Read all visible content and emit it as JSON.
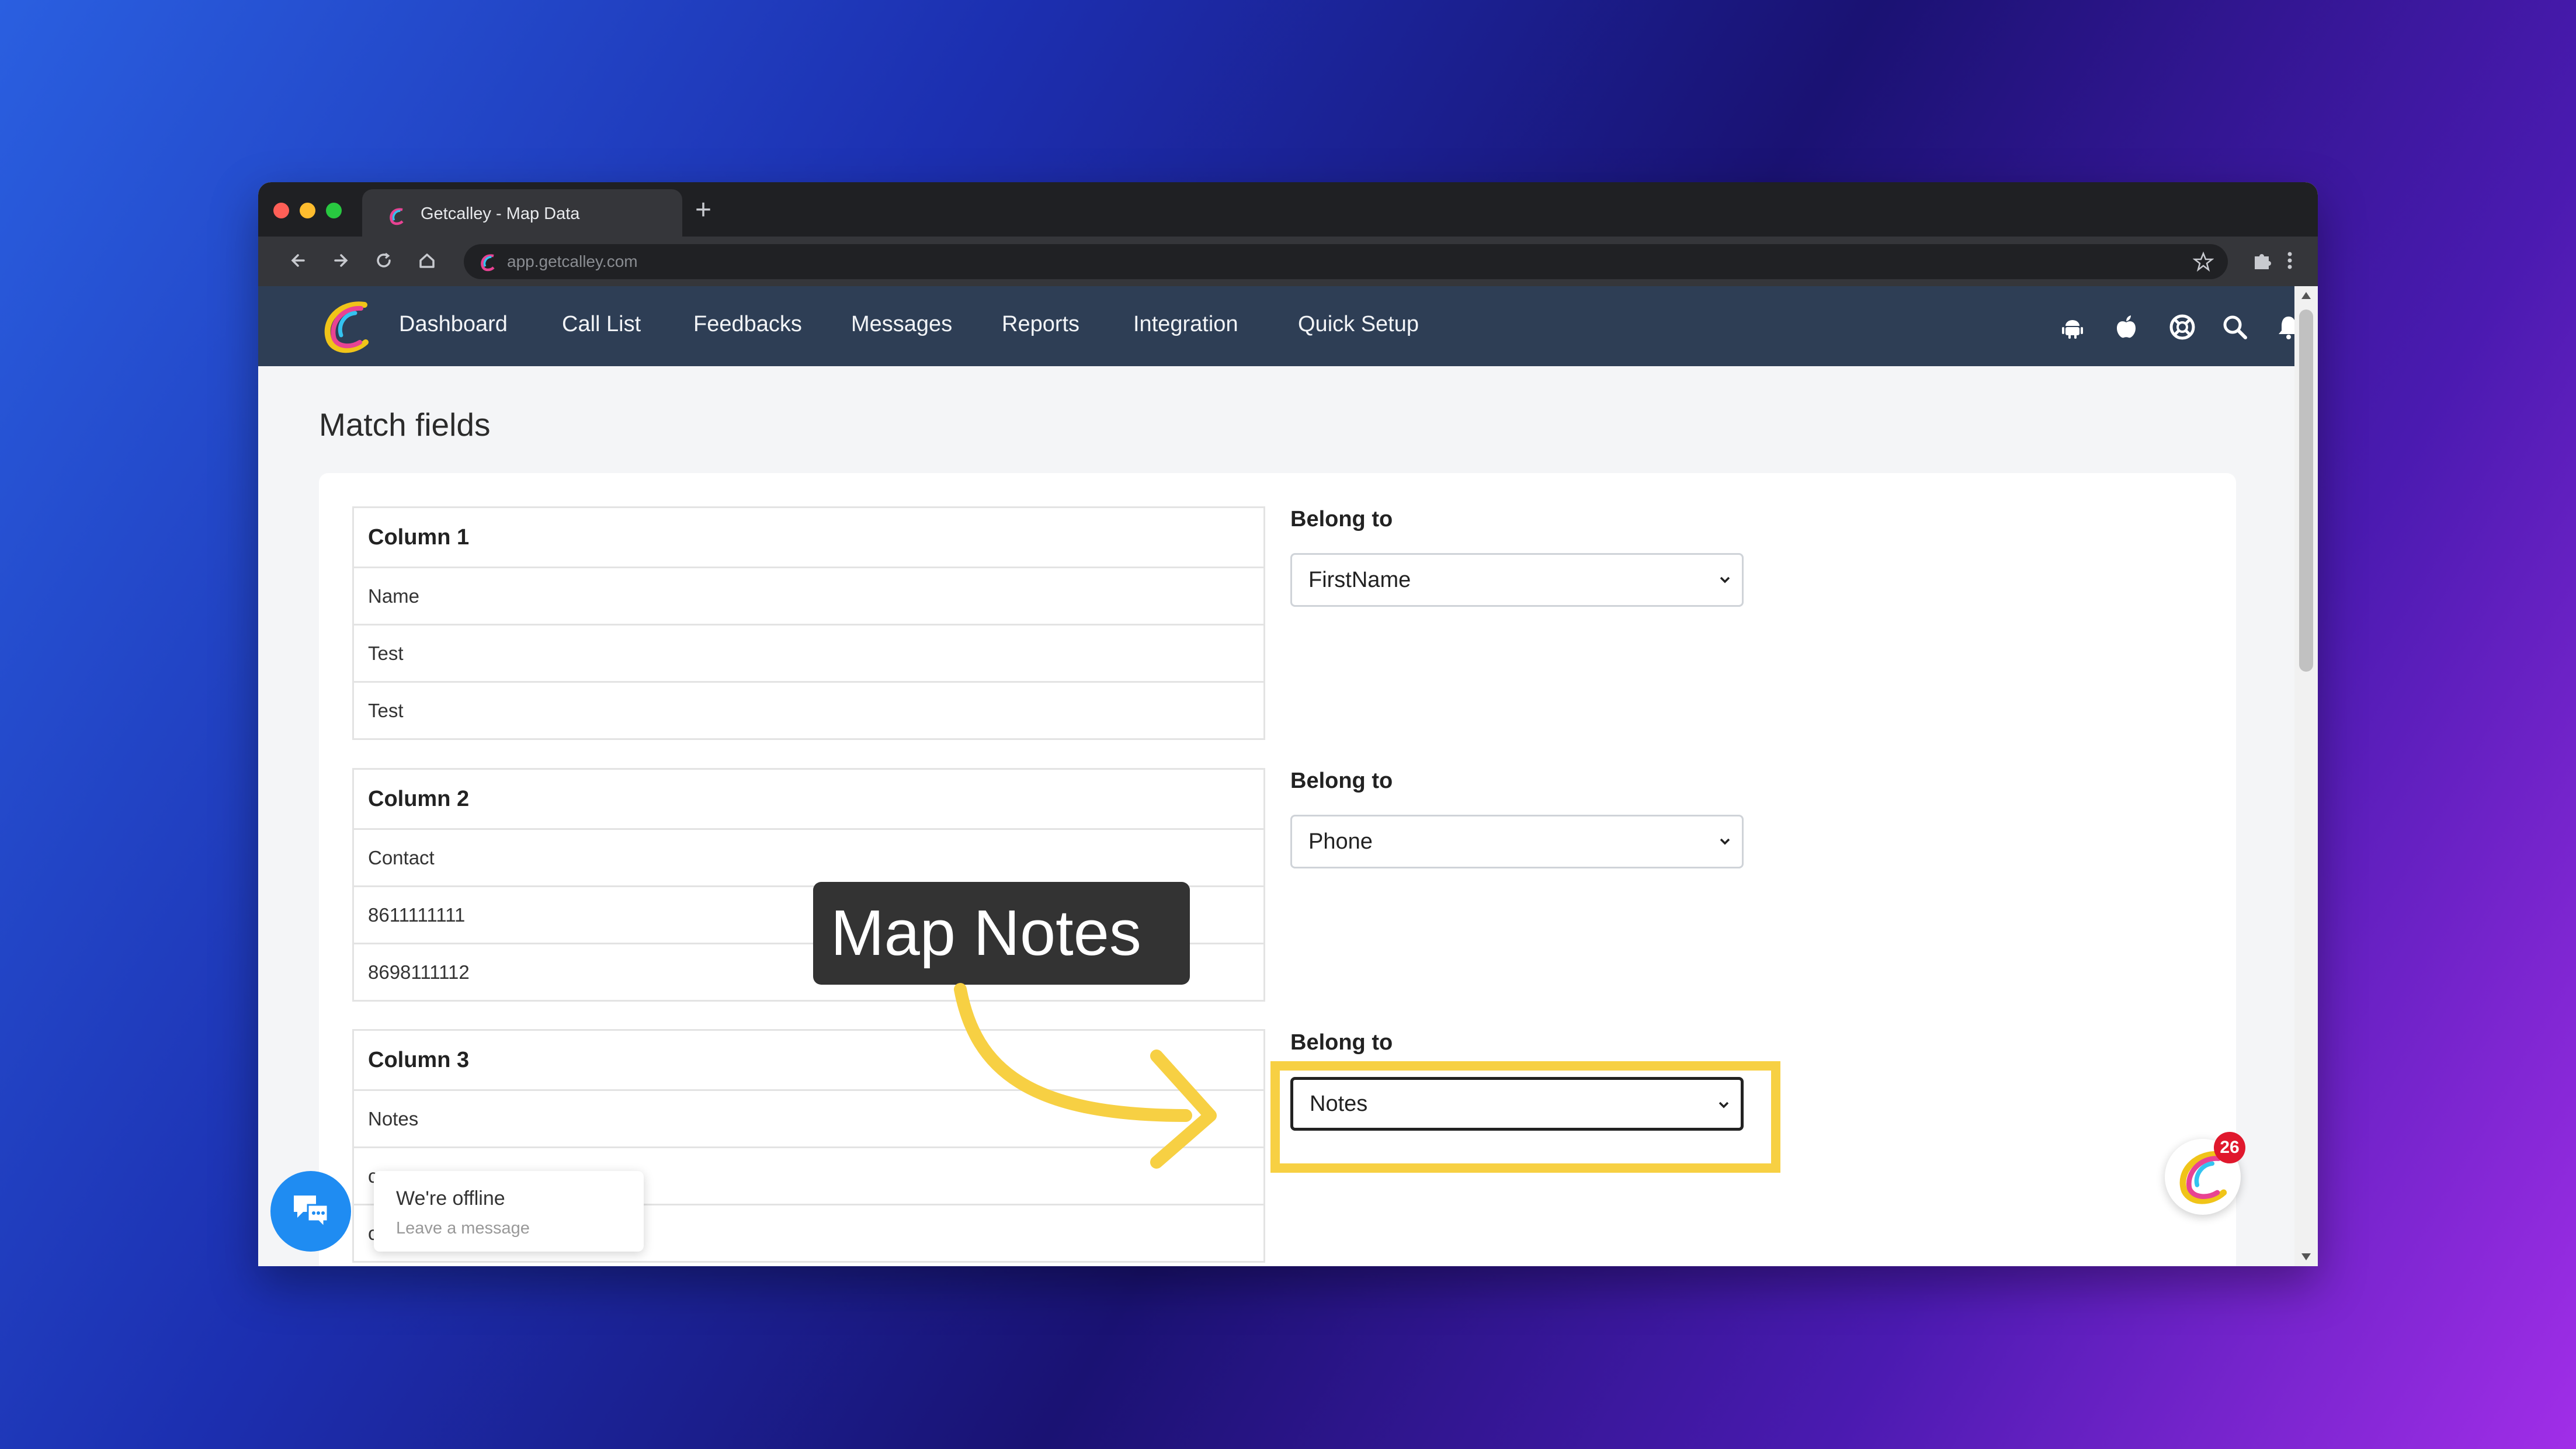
{
  "browser": {
    "tab_title": "Getcalley - Map Data",
    "new_tab_symbol": "+",
    "url": "app.getcalley.com"
  },
  "nav": {
    "items": [
      "Dashboard",
      "Call List",
      "Feedbacks",
      "Messages",
      "Reports",
      "Integration",
      "Quick Setup"
    ],
    "icons": [
      "android-icon",
      "apple-icon",
      "support-icon",
      "search-icon",
      "bell-icon",
      "user-icon"
    ]
  },
  "page": {
    "title": "Match fields"
  },
  "columns": [
    {
      "header": "Column 1",
      "rows": [
        "Name",
        "Test",
        "Test"
      ],
      "belong_label": "Belong to",
      "selected": "FirstName"
    },
    {
      "header": "Column 2",
      "rows": [
        "Contact",
        "8611111111",
        "8698111112"
      ],
      "belong_label": "Belong to",
      "selected": "Phone"
    },
    {
      "header": "Column 3",
      "rows": [
        "Notes",
        "c",
        "c"
      ],
      "belong_label": "Belong to",
      "selected": "Notes"
    }
  ],
  "callout": {
    "text": "Map Notes",
    "highlight_color": "#f7d043"
  },
  "chat": {
    "status": "We're offline",
    "prompt": "Leave a message"
  },
  "notification_badge": {
    "count": "26"
  },
  "colors": {
    "navbar": "#2e3e55",
    "accent_yellow": "#f7d043",
    "chat_blue": "#1f8cf2"
  }
}
